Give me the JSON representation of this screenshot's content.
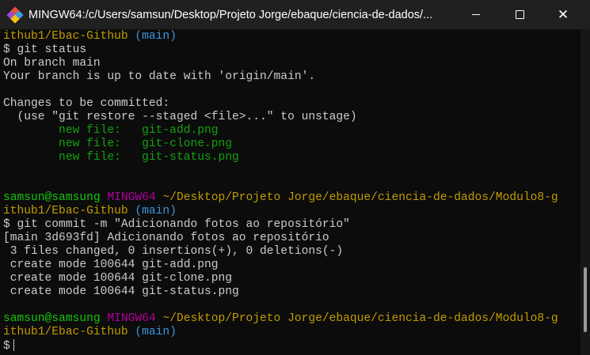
{
  "window": {
    "title": "MINGW64:/c/Users/samsun/Desktop/Projeto Jorge/ebaque/ciencia-de-dados/...",
    "minimize_icon": "minimize-icon",
    "maximize_icon": "maximize-icon",
    "close_icon": "close-icon"
  },
  "colors": {
    "default": "#cccccc",
    "green": "#13a10e",
    "prompt_green": "#16c60c",
    "magenta": "#b4009e",
    "yellow": "#c19c00",
    "cyan": "#3a96dd"
  },
  "terminal": {
    "lines": [
      [
        {
          "t": "ithub1/Ebac-Github",
          "c": "yellow"
        },
        {
          "t": " (main)",
          "c": "cyan"
        }
      ],
      [
        {
          "t": "$ git status",
          "c": "default"
        }
      ],
      [
        {
          "t": "On branch main",
          "c": "default"
        }
      ],
      [
        {
          "t": "Your branch is up to date with 'origin/main'.",
          "c": "default"
        }
      ],
      [],
      [
        {
          "t": "Changes to be committed:",
          "c": "default"
        }
      ],
      [
        {
          "t": "  (use \"git restore --staged <file>...\" to unstage)",
          "c": "default"
        }
      ],
      [
        {
          "t": "        new file:   git-add.png",
          "c": "green"
        }
      ],
      [
        {
          "t": "        new file:   git-clone.png",
          "c": "green"
        }
      ],
      [
        {
          "t": "        new file:   git-status.png",
          "c": "green"
        }
      ],
      [],
      [],
      [
        {
          "t": "samsun@samsung ",
          "c": "prompt_green"
        },
        {
          "t": "MINGW64 ",
          "c": "magenta"
        },
        {
          "t": "~/Desktop/Projeto Jorge/ebaque/ciencia-de-dados/Modulo8-g",
          "c": "yellow"
        }
      ],
      [
        {
          "t": "ithub1/Ebac-Github",
          "c": "yellow"
        },
        {
          "t": " (main)",
          "c": "cyan"
        }
      ],
      [
        {
          "t": "$ git commit -m \"Adicionando fotos ao repositório\"",
          "c": "default"
        }
      ],
      [
        {
          "t": "[main 3d693fd] Adicionando fotos ao repositório",
          "c": "default"
        }
      ],
      [
        {
          "t": " 3 files changed, 0 insertions(+), 0 deletions(-)",
          "c": "default"
        }
      ],
      [
        {
          "t": " create mode 100644 git-add.png",
          "c": "default"
        }
      ],
      [
        {
          "t": " create mode 100644 git-clone.png",
          "c": "default"
        }
      ],
      [
        {
          "t": " create mode 100644 git-status.png",
          "c": "default"
        }
      ],
      [],
      [
        {
          "t": "samsun@samsung ",
          "c": "prompt_green"
        },
        {
          "t": "MINGW64 ",
          "c": "magenta"
        },
        {
          "t": "~/Desktop/Projeto Jorge/ebaque/ciencia-de-dados/Modulo8-g",
          "c": "yellow"
        }
      ],
      [
        {
          "t": "ithub1/Ebac-Github",
          "c": "yellow"
        },
        {
          "t": " (main)",
          "c": "cyan"
        }
      ],
      [
        {
          "t": "$",
          "c": "default"
        }
      ]
    ]
  }
}
